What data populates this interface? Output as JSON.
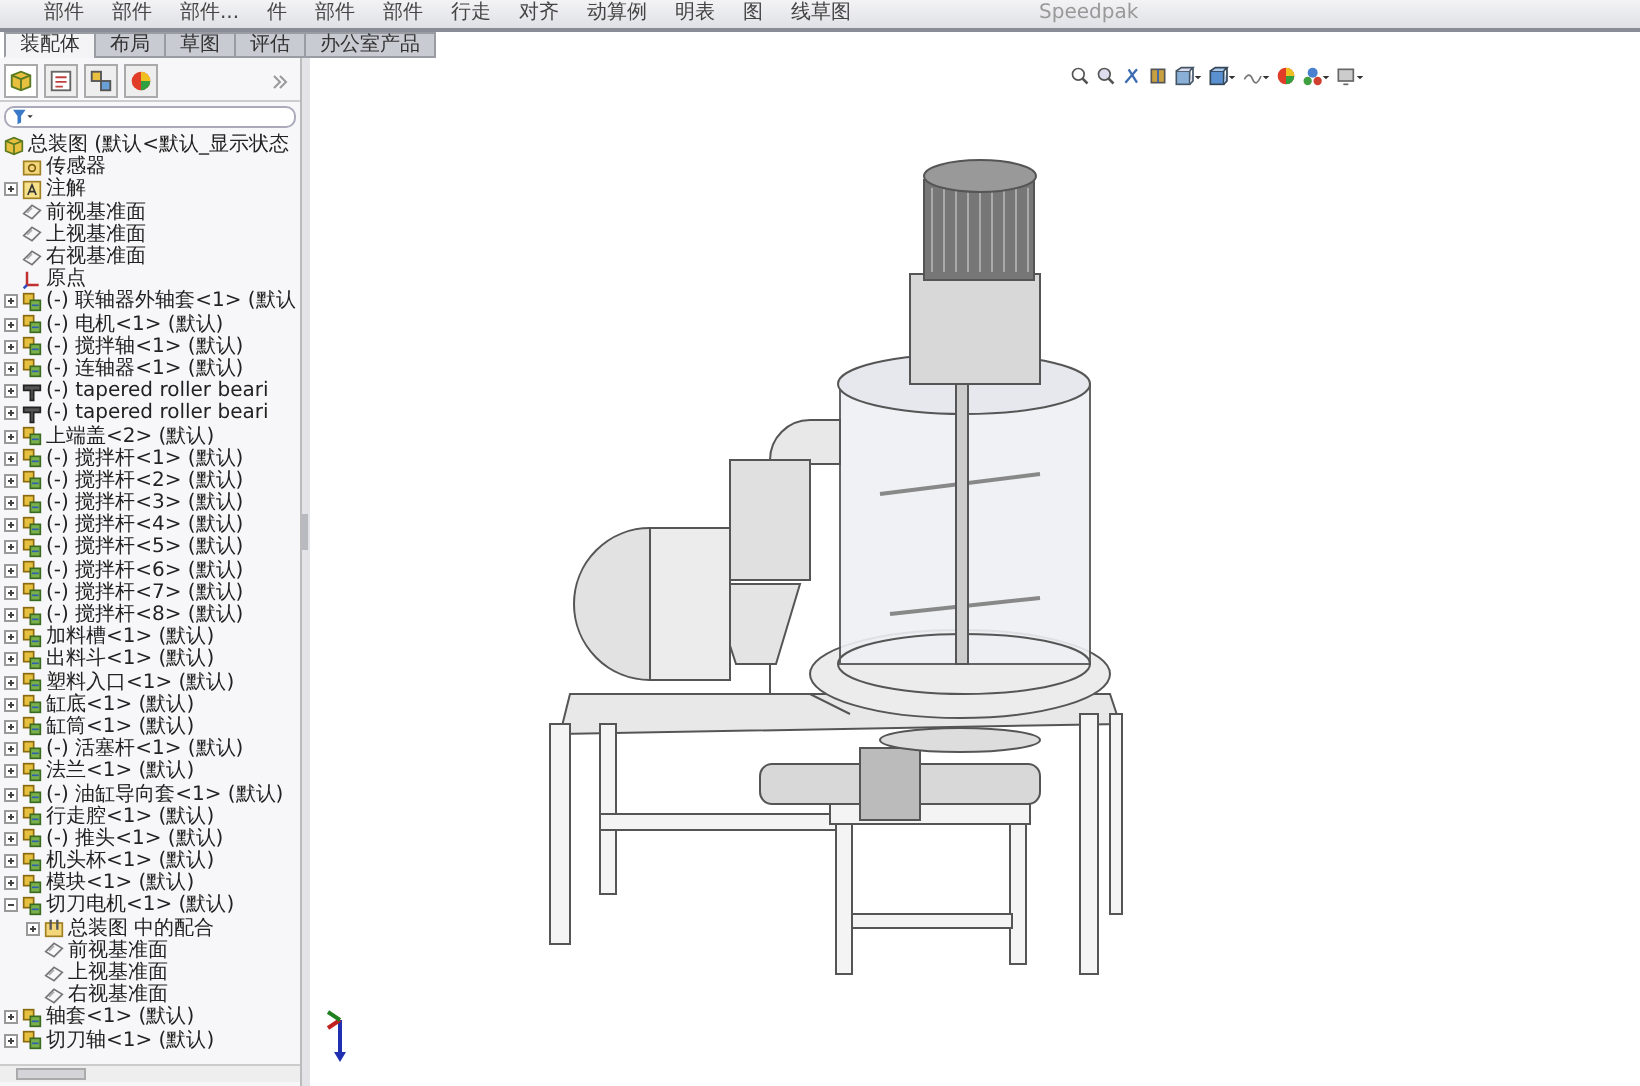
{
  "toolbar": {
    "items": [
      "部件",
      "部件",
      "部件...",
      "件",
      "部件",
      "部件",
      "行走",
      "对齐",
      "动算例",
      "明表",
      "图",
      "线草图",
      "Speedpak"
    ]
  },
  "tabs": [
    {
      "label": "装配体",
      "selected": true
    },
    {
      "label": "布局",
      "selected": false
    },
    {
      "label": "草图",
      "selected": false
    },
    {
      "label": "评估",
      "selected": false
    },
    {
      "label": "办公室产品",
      "selected": false
    }
  ],
  "feature_tree": {
    "items": [
      {
        "kind": "root",
        "label": "总装图 (默认<默认_显示状态",
        "children": [
          {
            "kind": "sensor",
            "label": "传感器"
          },
          {
            "kind": "annotation",
            "label": "注解",
            "expanded": false
          },
          {
            "kind": "plane",
            "label": "前视基准面"
          },
          {
            "kind": "plane",
            "label": "上视基准面"
          },
          {
            "kind": "plane",
            "label": "右视基准面"
          },
          {
            "kind": "origin",
            "label": "原点"
          },
          {
            "kind": "part",
            "label": "(-) 联轴器外轴套<1> (默认",
            "expanded": false
          },
          {
            "kind": "part",
            "label": "(-) 电机<1> (默认)",
            "expanded": false
          },
          {
            "kind": "part",
            "label": "(-) 搅拌轴<1> (默认)",
            "expanded": false
          },
          {
            "kind": "part",
            "label": "(-) 连轴器<1> (默认)",
            "expanded": false
          },
          {
            "kind": "bearing",
            "label": "(-) tapered roller beari",
            "expanded": false
          },
          {
            "kind": "bearing",
            "label": "(-) tapered roller beari",
            "expanded": false
          },
          {
            "kind": "part",
            "label": "上端盖<2> (默认)",
            "expanded": false
          },
          {
            "kind": "part",
            "label": "(-) 搅拌杆<1> (默认)",
            "expanded": false
          },
          {
            "kind": "part",
            "label": "(-) 搅拌杆<2> (默认)",
            "expanded": false
          },
          {
            "kind": "part",
            "label": "(-) 搅拌杆<3> (默认)",
            "expanded": false
          },
          {
            "kind": "part",
            "label": "(-) 搅拌杆<4> (默认)",
            "expanded": false
          },
          {
            "kind": "part",
            "label": "(-) 搅拌杆<5> (默认)",
            "expanded": false
          },
          {
            "kind": "part",
            "label": "(-) 搅拌杆<6> (默认)",
            "expanded": false
          },
          {
            "kind": "part",
            "label": "(-) 搅拌杆<7> (默认)",
            "expanded": false
          },
          {
            "kind": "part",
            "label": "(-) 搅拌杆<8> (默认)",
            "expanded": false
          },
          {
            "kind": "part",
            "label": "加料槽<1> (默认)",
            "expanded": false
          },
          {
            "kind": "part",
            "label": "出料斗<1> (默认)",
            "expanded": false
          },
          {
            "kind": "part",
            "label": "塑料入口<1> (默认)",
            "expanded": false
          },
          {
            "kind": "part",
            "label": "缸底<1> (默认)",
            "expanded": false
          },
          {
            "kind": "part",
            "label": "缸筒<1> (默认)",
            "expanded": false
          },
          {
            "kind": "part",
            "label": "(-) 活塞杆<1> (默认)",
            "expanded": false
          },
          {
            "kind": "part",
            "label": "法兰<1> (默认)",
            "expanded": false
          },
          {
            "kind": "part",
            "label": "(-) 油缸导向套<1> (默认)",
            "expanded": false
          },
          {
            "kind": "part",
            "label": "行走腔<1> (默认)",
            "expanded": false
          },
          {
            "kind": "part",
            "label": "(-) 推头<1> (默认)",
            "expanded": false
          },
          {
            "kind": "part",
            "label": "机头杯<1> (默认)",
            "expanded": false
          },
          {
            "kind": "part",
            "label": "模块<1> (默认)",
            "expanded": false
          },
          {
            "kind": "part",
            "label": "切刀电机<1> (默认)",
            "expanded": true,
            "children": [
              {
                "kind": "mates",
                "label": "总装图 中的配合",
                "expanded": false
              },
              {
                "kind": "plane",
                "label": "前视基准面"
              },
              {
                "kind": "plane",
                "label": "上视基准面"
              },
              {
                "kind": "plane",
                "label": "右视基准面"
              }
            ]
          },
          {
            "kind": "part",
            "label": "轴套<1> (默认)",
            "expanded": false
          },
          {
            "kind": "part",
            "label": "切刀轴<1> (默认)",
            "expanded": false
          }
        ]
      }
    ]
  }
}
